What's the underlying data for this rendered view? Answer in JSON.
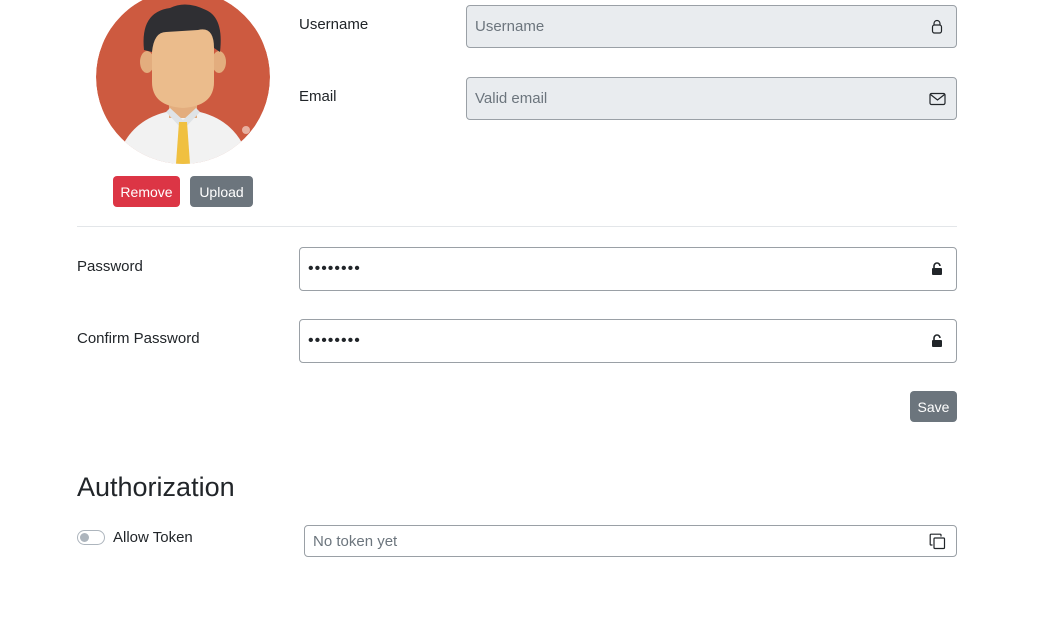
{
  "profile": {
    "remove_label": "Remove",
    "upload_label": "Upload",
    "username_label": "Username",
    "username_placeholder": "Username",
    "email_label": "Email",
    "email_placeholder": "Valid email"
  },
  "password": {
    "password_label": "Password",
    "password_value": "••••••••",
    "confirm_label": "Confirm Password",
    "confirm_value": "••••••••",
    "save_label": "Save"
  },
  "authorization": {
    "heading": "Authorization",
    "toggle_label": "Allow Token",
    "toggle_on": false,
    "token_placeholder": "No token yet"
  },
  "icons": {
    "username": "user-icon",
    "email": "envelope-icon",
    "password": "unlock-icon",
    "confirm": "unlock-icon",
    "token": "copy-icon"
  },
  "colors": {
    "danger": "#dc3545",
    "secondary": "#6c757d",
    "readonly_bg": "#e9ecef"
  }
}
